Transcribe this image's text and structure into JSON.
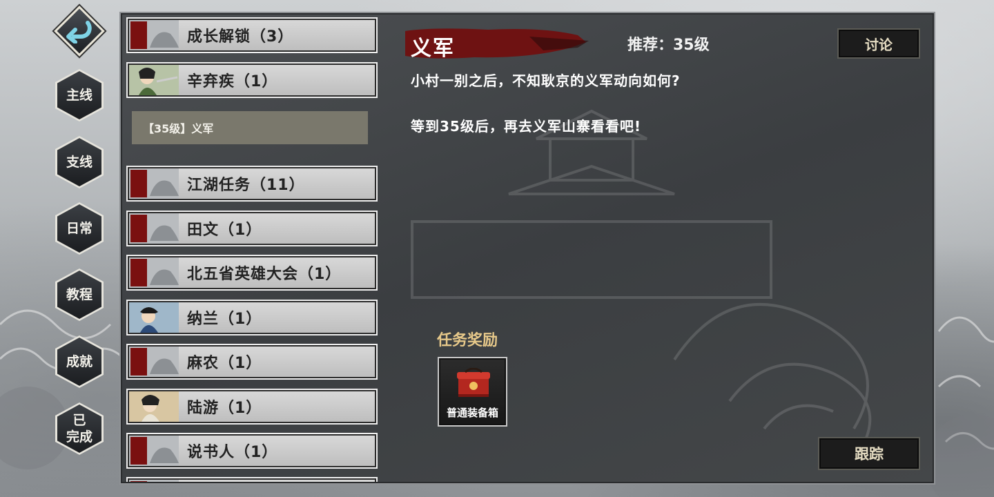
{
  "side_tabs": [
    {
      "label": "主线"
    },
    {
      "label": "支线"
    },
    {
      "label": "日常"
    },
    {
      "label": "教程"
    },
    {
      "label": "成就"
    },
    {
      "label": "已\n完成"
    }
  ],
  "quest_list": [
    {
      "label": "成长解锁（3）",
      "thumb": "seal"
    },
    {
      "label": "辛弃疾（1）",
      "thumb": "portrait-green"
    },
    {
      "label": "江湖任务（11）",
      "thumb": "seal"
    },
    {
      "label": "田文（1）",
      "thumb": "seal"
    },
    {
      "label": "北五省英雄大会（1）",
      "thumb": "seal"
    },
    {
      "label": "纳兰（1）",
      "thumb": "portrait-blue"
    },
    {
      "label": "麻农（1）",
      "thumb": "seal"
    },
    {
      "label": "陆游（1）",
      "thumb": "portrait-tan"
    },
    {
      "label": "说书人（1）",
      "thumb": "seal"
    }
  ],
  "selected_subquest": "【35级】义军",
  "detail": {
    "title": "义军",
    "recommend": "推荐：35级",
    "discuss_label": "讨论",
    "desc_line1": "小村一别之后，不知耿京的义军动向如何?",
    "desc_line2": "等到35级后，再去义军山寨看看吧!",
    "reward_title": "任务奖励",
    "reward_item": "普通装备箱",
    "track_label": "跟踪"
  },
  "colors": {
    "panel": "#3f4245",
    "title_brush": "#7a1414",
    "reward_title": "#e7c98a",
    "button_text": "#e5dcc2"
  }
}
